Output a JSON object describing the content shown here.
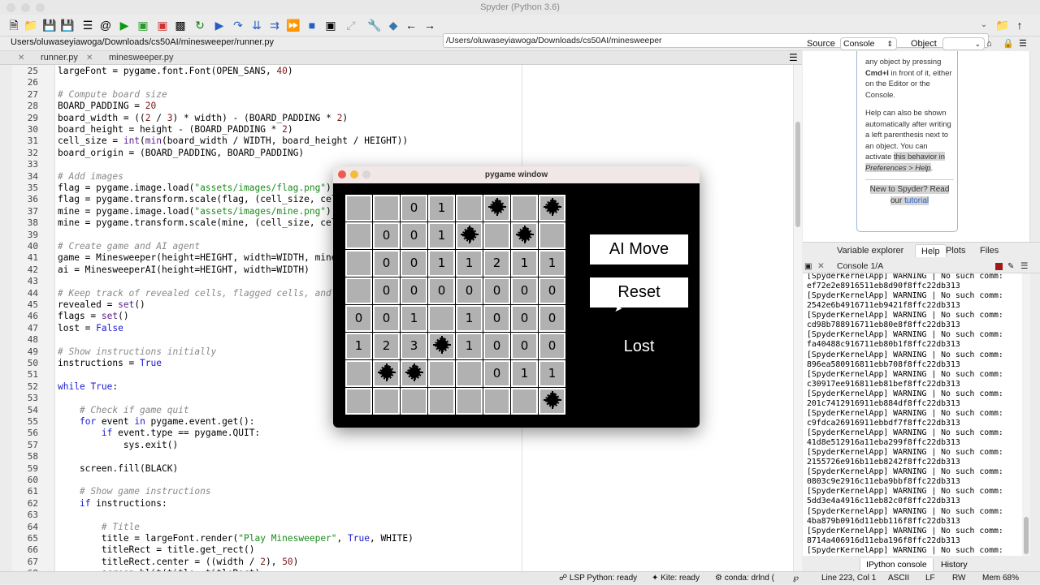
{
  "window": {
    "title": "Spyder (Python 3.6)"
  },
  "toolbar": {
    "path": "/Users/oluwaseyiawoga/Downloads/cs50AI/minesweeper"
  },
  "editor": {
    "file_path": "Users/oluwaseyiawoga/Downloads/cs50AI/minesweeper/runner.py",
    "tabs": [
      {
        "label": "runner.py"
      },
      {
        "label": "minesweeper.py"
      }
    ],
    "lines": [
      {
        "n": "25",
        "t": "largeFont = pygame.font.Font(OPEN_SANS, 40)"
      },
      {
        "n": "26",
        "t": ""
      },
      {
        "n": "27",
        "t": "# Compute board size"
      },
      {
        "n": "28",
        "t": "BOARD_PADDING = 20"
      },
      {
        "n": "29",
        "t": "board_width = ((2 / 3) * width) - (BOARD_PADDING * 2)"
      },
      {
        "n": "30",
        "t": "board_height = height - (BOARD_PADDING * 2)"
      },
      {
        "n": "31",
        "t": "cell_size = int(min(board_width / WIDTH, board_height / HEIGHT))"
      },
      {
        "n": "32",
        "t": "board_origin = (BOARD_PADDING, BOARD_PADDING)"
      },
      {
        "n": "33",
        "t": ""
      },
      {
        "n": "34",
        "t": "# Add images"
      },
      {
        "n": "35",
        "t": "flag = pygame.image.load(\"assets/images/flag.png\")"
      },
      {
        "n": "36",
        "t": "flag = pygame.transform.scale(flag, (cell_size, cell_size))"
      },
      {
        "n": "37",
        "t": "mine = pygame.image.load(\"assets/images/mine.png\")"
      },
      {
        "n": "38",
        "t": "mine = pygame.transform.scale(mine, (cell_size, cell_size))"
      },
      {
        "n": "39",
        "t": ""
      },
      {
        "n": "40",
        "t": "# Create game and AI agent"
      },
      {
        "n": "41",
        "t": "game = Minesweeper(height=HEIGHT, width=WIDTH, mines=MINES)"
      },
      {
        "n": "42",
        "t": "ai = MinesweeperAI(height=HEIGHT, width=WIDTH)"
      },
      {
        "n": "43",
        "t": ""
      },
      {
        "n": "44",
        "t": "# Keep track of revealed cells, flagged cells, and if a mine was hit"
      },
      {
        "n": "45",
        "t": "revealed = set()"
      },
      {
        "n": "46",
        "t": "flags = set()"
      },
      {
        "n": "47",
        "t": "lost = False"
      },
      {
        "n": "48",
        "t": ""
      },
      {
        "n": "49",
        "t": "# Show instructions initially"
      },
      {
        "n": "50",
        "t": "instructions = True"
      },
      {
        "n": "51",
        "t": ""
      },
      {
        "n": "52",
        "t": "while True:"
      },
      {
        "n": "53",
        "t": ""
      },
      {
        "n": "54",
        "t": "    # Check if game quit"
      },
      {
        "n": "55",
        "t": "    for event in pygame.event.get():"
      },
      {
        "n": "56",
        "t": "        if event.type == pygame.QUIT:"
      },
      {
        "n": "57",
        "t": "            sys.exit()"
      },
      {
        "n": "58",
        "t": ""
      },
      {
        "n": "59",
        "t": "    screen.fill(BLACK)"
      },
      {
        "n": "60",
        "t": ""
      },
      {
        "n": "61",
        "t": "    # Show game instructions"
      },
      {
        "n": "62",
        "t": "    if instructions:"
      },
      {
        "n": "63",
        "t": ""
      },
      {
        "n": "64",
        "t": "        # Title"
      },
      {
        "n": "65",
        "t": "        title = largeFont.render(\"Play Minesweeper\", True, WHITE)"
      },
      {
        "n": "66",
        "t": "        titleRect = title.get_rect()"
      },
      {
        "n": "67",
        "t": "        titleRect.center = ((width / 2), 50)"
      },
      {
        "n": "68",
        "t": "        screen.blit(title, titleRect)"
      }
    ]
  },
  "pygame": {
    "title": "pygame window",
    "board": [
      [
        "",
        "",
        "0",
        "1",
        "",
        "*",
        "",
        "*"
      ],
      [
        "",
        "0",
        "0",
        "1",
        "*",
        "",
        "*",
        ""
      ],
      [
        "",
        "0",
        "0",
        "1",
        "1",
        "2",
        "1",
        "1"
      ],
      [
        "",
        "0",
        "0",
        "0",
        "0",
        "0",
        "0",
        "0"
      ],
      [
        "0",
        "0",
        "1",
        "",
        "1",
        "0",
        "0",
        "0"
      ],
      [
        "1",
        "2",
        "3",
        "*",
        "1",
        "0",
        "0",
        "0"
      ],
      [
        "",
        "*",
        "*",
        "",
        "",
        "0",
        "1",
        "1"
      ],
      [
        "",
        "",
        "",
        "",
        "",
        "",
        "",
        "*"
      ]
    ],
    "ai_move_label": "AI Move",
    "reset_label": "Reset",
    "status": "Lost"
  },
  "help": {
    "source_label": "Source",
    "source_value": "Console",
    "object_label": "Object",
    "p1a": "any object by pressing",
    "p1b": "Cmd+I",
    "p1c": " in front of it, either on the Editor or the Console.",
    "p2a": "Help can also be shown automatically after writing a left parenthesis next to an object. You can activate ",
    "p2b": "this behavior in",
    "p2c": "Preferences > Help",
    "p2d": ".",
    "p3a": "New to Spyder? Read our ",
    "p3b": "tutorial"
  },
  "pane_tabs": [
    {
      "label": "Variable explorer"
    },
    {
      "label": "Help"
    },
    {
      "label": "Plots"
    },
    {
      "label": "Files"
    }
  ],
  "console": {
    "tab": "Console 1/A",
    "lines": [
      "[SpyderKernelApp] WARNING | No such comm:",
      "ef72e2e8916511eb8d90f8ffc22db313",
      "[SpyderKernelApp] WARNING | No such comm:",
      "2542e6b4916711eb9421f8ffc22db313",
      "[SpyderKernelApp] WARNING | No such comm:",
      "cd98b788916711eb80e8f8ffc22db313",
      "[SpyderKernelApp] WARNING | No such comm:",
      "fa40488c916711eb80b1f8ffc22db313",
      "[SpyderKernelApp] WARNING | No such comm:",
      "896ea580916811ebb708f8ffc22db313",
      "[SpyderKernelApp] WARNING | No such comm:",
      "c30917ee916811eb81bef8ffc22db313",
      "[SpyderKernelApp] WARNING | No such comm:",
      "201c741291691 1eb884df8ffc22db313",
      "[SpyderKernelApp] WARNING | No such comm:",
      "c9fdca26916911ebbdf7f8ffc22db313",
      "[SpyderKernelApp] WARNING | No such comm:",
      "41d8e512916a11eba299f8ffc22db313",
      "[SpyderKernelApp] WARNING | No such comm:",
      "2155726e916b11eb8242f8ffc22db313",
      "[SpyderKernelApp] WARNING | No such comm:",
      "0803c9e2916c11eba9bbf8ffc22db313",
      "[SpyderKernelApp] WARNING | No such comm:",
      "5dd3e4a4916c11eb82c0f8ffc22db313",
      "[SpyderKernelApp] WARNING | No such comm:",
      "4ba879b0916d11ebb116f8ffc22db313",
      "[SpyderKernelApp] WARNING | No such comm:",
      "8714a406916d11eba196f8ffc22db313",
      "[SpyderKernelApp] WARNING | No such comm:"
    ]
  },
  "bottom_tabs": [
    {
      "label": "IPython console"
    },
    {
      "label": "History"
    }
  ],
  "status": {
    "lsp": "LSP Python: ready",
    "kite": "Kite: ready",
    "conda": "conda: drlnd (",
    "position": "Line 223, Col 1",
    "encoding": "ASCII",
    "eol": "LF",
    "rw": "RW",
    "mem": "Mem 68%"
  }
}
